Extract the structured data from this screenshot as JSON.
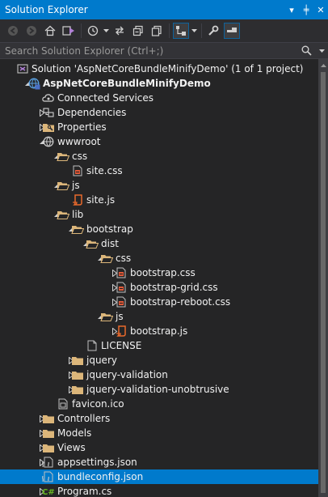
{
  "window": {
    "title": "Solution Explorer",
    "buttons": [
      "▾",
      "╪",
      "✕"
    ]
  },
  "search": {
    "placeholder": "Search Solution Explorer (Ctrl+;)"
  },
  "tree": {
    "items": [
      {
        "label": "Solution 'AspNetCoreBundleMinifyDemo' (1 of 1 project)",
        "icon": "solution-icon",
        "expander": "none",
        "bold": false
      },
      {
        "label": "AspNetCoreBundleMinifyDemo",
        "icon": "web-project-icon",
        "expander": "expanded",
        "bold": true
      },
      {
        "label": "Connected Services",
        "icon": "connected-services-icon",
        "expander": "none",
        "bold": false
      },
      {
        "label": "Dependencies",
        "icon": "dependencies-icon",
        "expander": "collapsed",
        "bold": false
      },
      {
        "label": "Properties",
        "icon": "properties-folder-icon",
        "expander": "collapsed",
        "bold": false
      },
      {
        "label": "wwwroot",
        "icon": "globe-icon",
        "expander": "expanded",
        "bold": false
      },
      {
        "label": "css",
        "icon": "folder-open-icon",
        "expander": "expanded",
        "bold": false
      },
      {
        "label": "site.css",
        "icon": "css-file-icon",
        "expander": "none",
        "bold": false
      },
      {
        "label": "js",
        "icon": "folder-open-icon",
        "expander": "expanded",
        "bold": false
      },
      {
        "label": "site.js",
        "icon": "js-file-icon",
        "expander": "none",
        "bold": false
      },
      {
        "label": "lib",
        "icon": "folder-open-icon",
        "expander": "expanded",
        "bold": false
      },
      {
        "label": "bootstrap",
        "icon": "folder-open-icon",
        "expander": "expanded",
        "bold": false
      },
      {
        "label": "dist",
        "icon": "folder-open-icon",
        "expander": "expanded",
        "bold": false
      },
      {
        "label": "css",
        "icon": "folder-open-icon",
        "expander": "expanded",
        "bold": false
      },
      {
        "label": "bootstrap.css",
        "icon": "css-file-icon",
        "expander": "collapsed",
        "bold": false
      },
      {
        "label": "bootstrap-grid.css",
        "icon": "css-file-icon",
        "expander": "collapsed",
        "bold": false
      },
      {
        "label": "bootstrap-reboot.css",
        "icon": "css-file-icon",
        "expander": "collapsed",
        "bold": false
      },
      {
        "label": "js",
        "icon": "folder-open-icon",
        "expander": "expanded",
        "bold": false
      },
      {
        "label": "bootstrap.js",
        "icon": "js-file-icon",
        "expander": "collapsed",
        "bold": false
      },
      {
        "label": "LICENSE",
        "icon": "file-icon",
        "expander": "none",
        "bold": false
      },
      {
        "label": "jquery",
        "icon": "folder-icon",
        "expander": "collapsed",
        "bold": false
      },
      {
        "label": "jquery-validation",
        "icon": "folder-icon",
        "expander": "collapsed",
        "bold": false
      },
      {
        "label": "jquery-validation-unobtrusive",
        "icon": "folder-icon",
        "expander": "collapsed",
        "bold": false
      },
      {
        "label": "favicon.ico",
        "icon": "icon-file-icon",
        "expander": "none",
        "bold": false
      },
      {
        "label": "Controllers",
        "icon": "folder-icon",
        "expander": "collapsed",
        "bold": false
      },
      {
        "label": "Models",
        "icon": "folder-icon",
        "expander": "collapsed",
        "bold": false
      },
      {
        "label": "Views",
        "icon": "folder-icon",
        "expander": "collapsed",
        "bold": false
      },
      {
        "label": "appsettings.json",
        "icon": "json-file-icon",
        "expander": "collapsed",
        "bold": false
      },
      {
        "label": "bundleconfig.json",
        "icon": "json-file-icon",
        "expander": "none",
        "bold": false,
        "selected": true
      },
      {
        "label": "Program.cs",
        "icon": "csharp-file-icon",
        "expander": "collapsed",
        "bold": false
      }
    ]
  },
  "colors": {
    "accent": "#007acc",
    "background": "#252526",
    "folder": "#dcb67a",
    "css": "#e05a3a",
    "js": "#e8692c",
    "csharp": "#68b723"
  }
}
